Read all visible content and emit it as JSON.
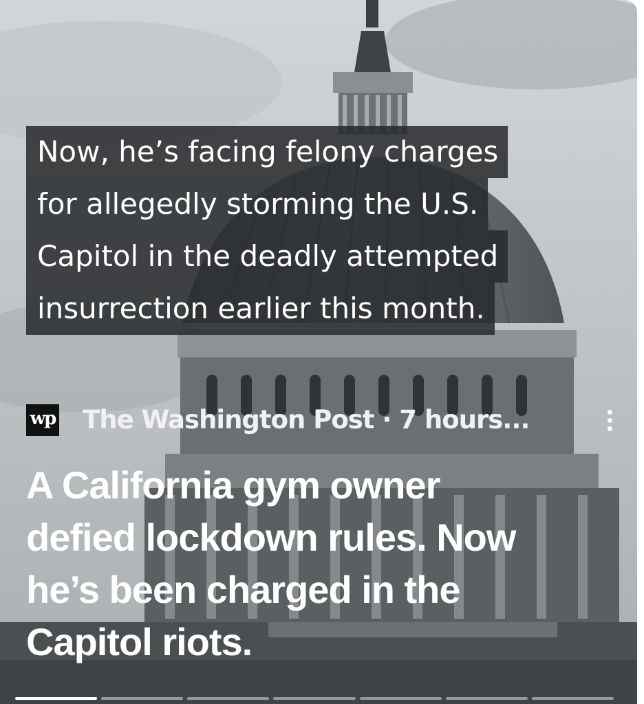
{
  "story": {
    "caption_lines": [
      "Now, he’s facing felony charges",
      "for allegedly storming the U.S.",
      "Capitol in the deadly attempted",
      "insurrection earlier this month."
    ],
    "source": {
      "logo_text": "wp",
      "text": "The Washington Post · 7 hours..."
    },
    "headline_lines": [
      "A California gym owner",
      "defied lockdown rules. Now",
      "he’s been charged in the",
      "Capitol riots."
    ],
    "progress": {
      "segments": 7,
      "active_index": 0
    }
  },
  "icons": {
    "more": "more-vert-icon",
    "logo": "washington-post-logo"
  }
}
